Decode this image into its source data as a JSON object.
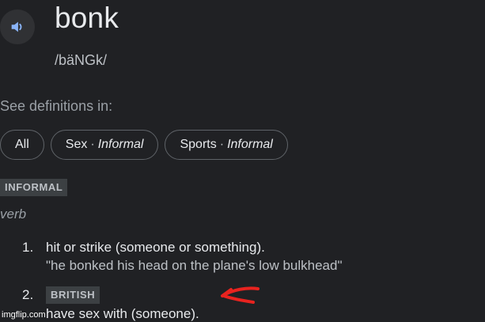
{
  "entry": {
    "word": "bonk",
    "phonetic": "/bäNGk/",
    "speaker_icon": "speaker-icon"
  },
  "definitions_in": {
    "label": "See definitions in:",
    "chips": [
      {
        "label": "All",
        "sep": "",
        "qualifier": ""
      },
      {
        "label": "Sex",
        "sep": "·",
        "qualifier": "Informal"
      },
      {
        "label": "Sports",
        "sep": "·",
        "qualifier": "Informal"
      }
    ]
  },
  "register_label": "INFORMAL",
  "part_of_speech": "verb",
  "senses": [
    {
      "number": "1.",
      "definition": "hit or strike (someone or something).",
      "example": "\"he bonked his head on the plane's low bulkhead\""
    },
    {
      "number": "2.",
      "region_label": "BRITISH",
      "definition": "have sex with (someone)."
    }
  ],
  "annotation": {
    "arrow_color": "#e8231f"
  },
  "watermark": "imgflip.com",
  "colors": {
    "background": "#202124",
    "text": "#e8eaed",
    "muted": "#9aa0a6",
    "badge_bg": "#3c4043",
    "chip_border": "#5f6368"
  }
}
